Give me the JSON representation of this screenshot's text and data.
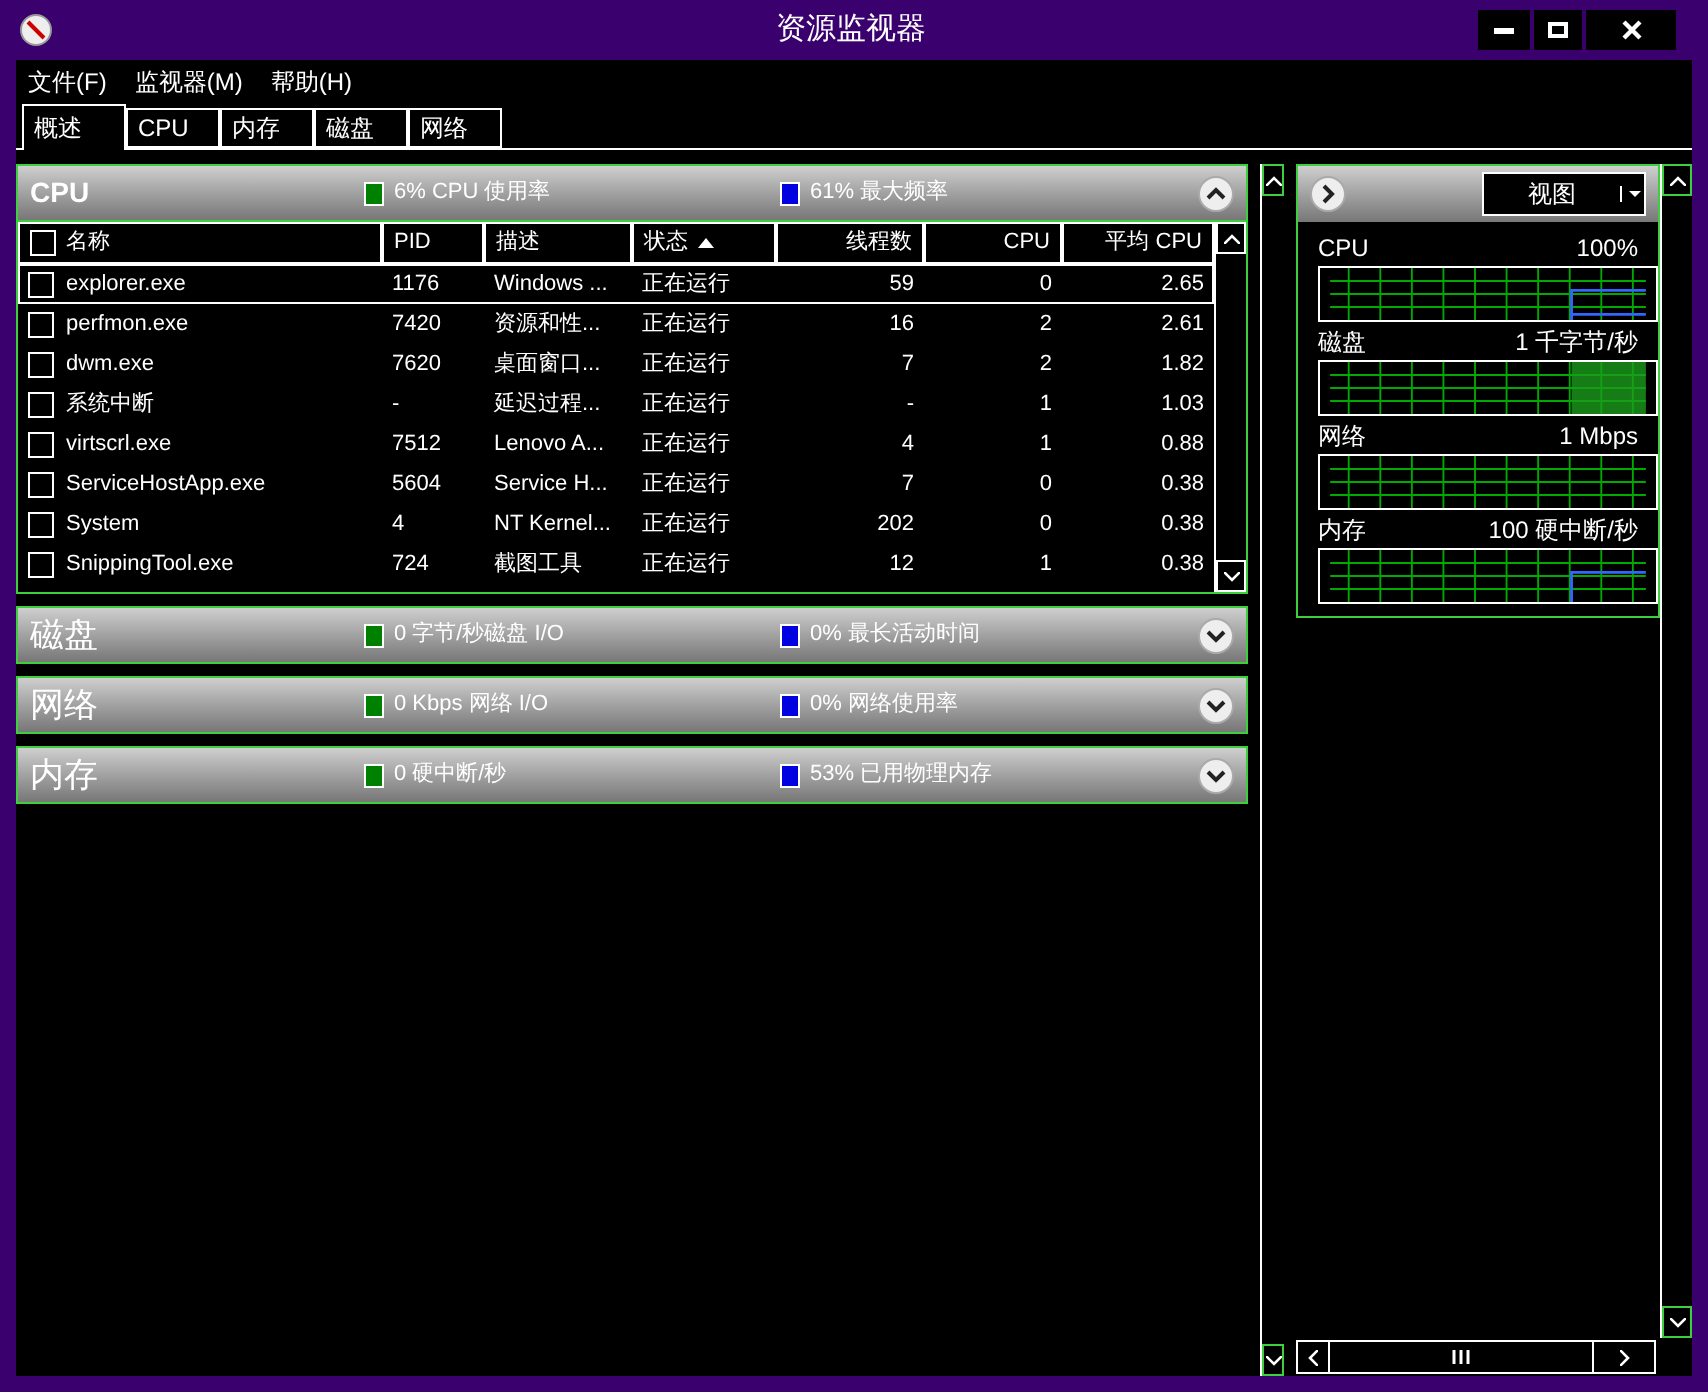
{
  "window": {
    "title": "资源监视器"
  },
  "menu": [
    "文件(F)",
    "监视器(M)",
    "帮助(H)"
  ],
  "tabs": [
    {
      "label": "概述",
      "selected": true
    },
    {
      "label": "CPU",
      "selected": false
    },
    {
      "label": "内存",
      "selected": false
    },
    {
      "label": "磁盘",
      "selected": false
    },
    {
      "label": "网络",
      "selected": false
    }
  ],
  "sections": [
    {
      "title": "CPU",
      "expanded": true,
      "stats": [
        {
          "text": "6% CPU 使用率",
          "color": "#008000"
        },
        {
          "text": "61% 最大频率",
          "color": "#0000e0"
        }
      ],
      "table": {
        "columns": [
          {
            "label": "名称",
            "sorted": false
          },
          {
            "label": "PID",
            "sorted": false
          },
          {
            "label": "描述",
            "sorted": false
          },
          {
            "label": "状态",
            "sorted": true
          },
          {
            "label": "线程数",
            "sorted": false
          },
          {
            "label": "CPU",
            "sorted": false
          },
          {
            "label": "平均 CPU",
            "sorted": false
          }
        ],
        "rows": [
          {
            "checked": false,
            "selected": true,
            "cells": [
              "explorer.exe",
              "1176",
              "Windows ...",
              "正在运行",
              "59",
              "0",
              "2.65"
            ]
          },
          {
            "checked": false,
            "selected": false,
            "cells": [
              "perfmon.exe",
              "7420",
              "资源和性...",
              "正在运行",
              "16",
              "2",
              "2.61"
            ]
          },
          {
            "checked": false,
            "selected": false,
            "cells": [
              "dwm.exe",
              "7620",
              "桌面窗口...",
              "正在运行",
              "7",
              "2",
              "1.82"
            ]
          },
          {
            "checked": false,
            "selected": false,
            "cells": [
              "系统中断",
              "-",
              "延迟过程...",
              "正在运行",
              "-",
              "1",
              "1.03"
            ]
          },
          {
            "checked": false,
            "selected": false,
            "cells": [
              "virtscrl.exe",
              "7512",
              "Lenovo A...",
              "正在运行",
              "4",
              "1",
              "0.88"
            ]
          },
          {
            "checked": false,
            "selected": false,
            "cells": [
              "ServiceHostApp.exe",
              "5604",
              "Service H...",
              "正在运行",
              "7",
              "0",
              "0.38"
            ]
          },
          {
            "checked": false,
            "selected": false,
            "cells": [
              "System",
              "4",
              "NT Kernel...",
              "正在运行",
              "202",
              "0",
              "0.38"
            ]
          },
          {
            "checked": false,
            "selected": false,
            "cells": [
              "SnippingTool.exe",
              "724",
              "截图工具",
              "正在运行",
              "12",
              "1",
              "0.38"
            ]
          }
        ]
      }
    },
    {
      "title": "磁盘",
      "expanded": false,
      "stats": [
        {
          "text": "0 字节/秒磁盘 I/O",
          "color": "#008000"
        },
        {
          "text": "0% 最长活动时间",
          "color": "#0000e0"
        }
      ]
    },
    {
      "title": "网络",
      "expanded": false,
      "stats": [
        {
          "text": "0 Kbps 网络 I/O",
          "color": "#008000"
        },
        {
          "text": "0% 网络使用率",
          "color": "#0000e0"
        }
      ]
    },
    {
      "title": "内存",
      "expanded": false,
      "stats": [
        {
          "text": "0 硬中断/秒",
          "color": "#008000"
        },
        {
          "text": "53% 已用物理内存",
          "color": "#0000e0"
        }
      ]
    }
  ],
  "side_panel": {
    "view_button": "视图",
    "graphs": [
      {
        "label": "CPU",
        "value": "100%"
      },
      {
        "label": "磁盘",
        "value": "1 千字节/秒"
      },
      {
        "label": "网络",
        "value": "1 Mbps"
      },
      {
        "label": "内存",
        "value": "100 硬中断/秒"
      }
    ]
  }
}
